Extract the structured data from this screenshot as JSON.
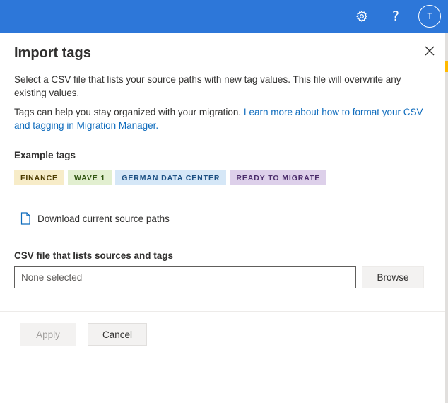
{
  "header": {
    "settings_icon": "gear-icon",
    "help_glyph": "?",
    "avatar_initial": "T",
    "bar_color": "#2d77d9"
  },
  "panel": {
    "title": "Import tags",
    "description_1": "Select a CSV file that lists your source paths with new tag values. This file will overwrite any existing values.",
    "description_2_text": "Tags can help you stay organized with your migration. ",
    "description_2_link": "Learn more about how to format your CSV and tagging in Migration Manager.",
    "example_label": "Example tags",
    "tags": [
      {
        "label": "FINANCE",
        "bg": "#f7ecc8",
        "fg": "#4d3b00"
      },
      {
        "label": "WAVE 1",
        "bg": "#e2efd0",
        "fg": "#2f5510"
      },
      {
        "label": "GERMAN DATA CENTER",
        "bg": "#d5e7f7",
        "fg": "#1b4f82"
      },
      {
        "label": "READY TO MIGRATE",
        "bg": "#ddd0ea",
        "fg": "#4b2c6b"
      }
    ],
    "download_label": "Download current source paths",
    "csv_label": "CSV file that lists sources and tags",
    "csv_input_placeholder": "None selected",
    "csv_input_value": "",
    "browse_label": "Browse"
  },
  "footer": {
    "apply_label": "Apply",
    "cancel_label": "Cancel"
  }
}
